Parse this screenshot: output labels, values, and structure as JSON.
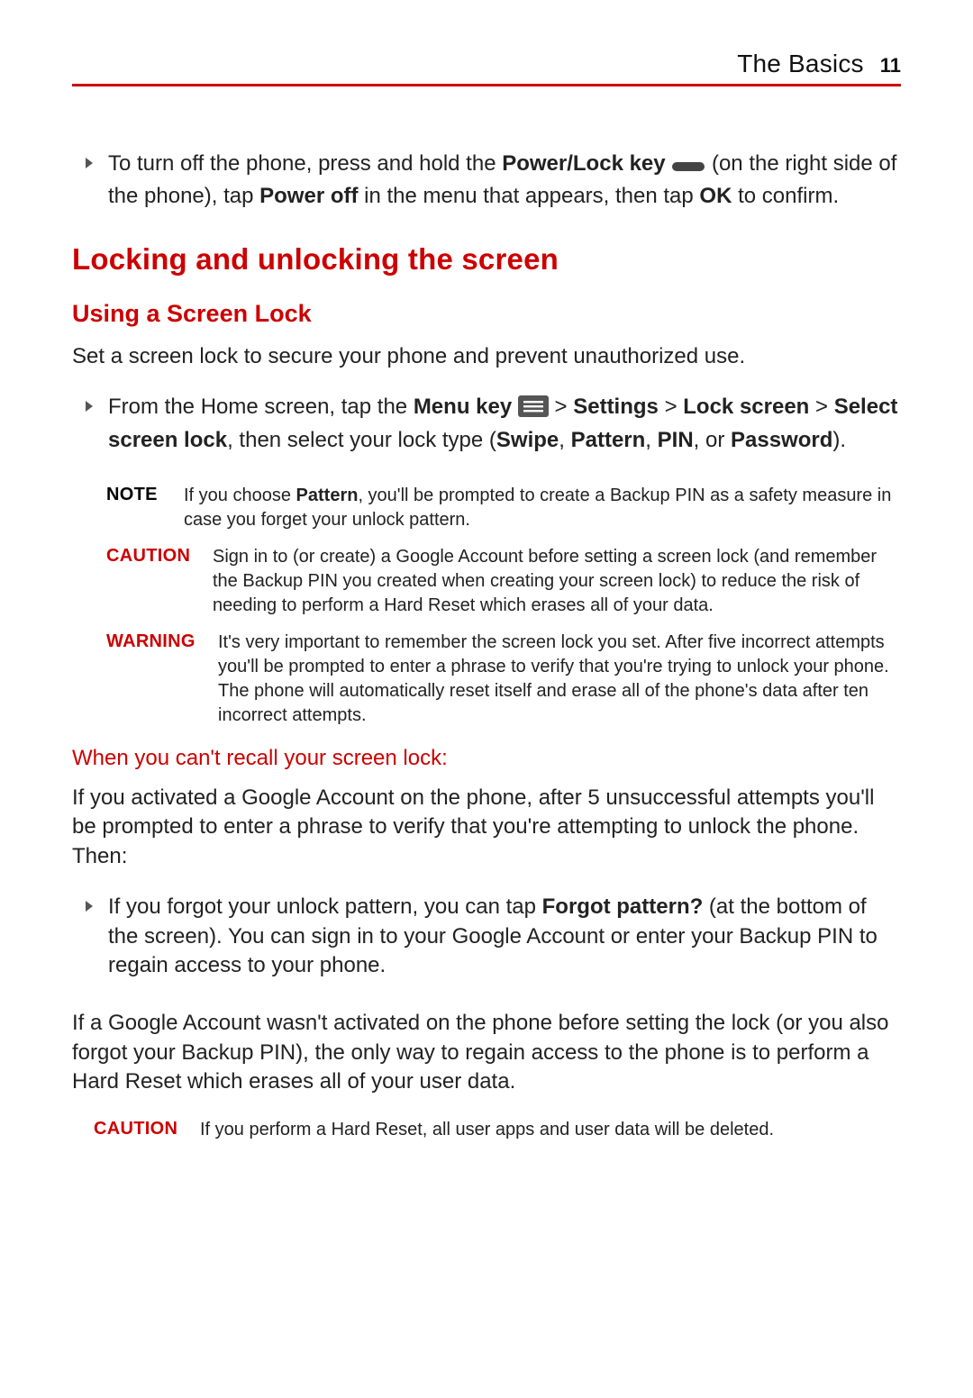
{
  "header": {
    "section": "The Basics",
    "page_number": "11"
  },
  "colors": {
    "accent": "#c00"
  },
  "bullet_power_off": {
    "pre_key": "To turn off the phone, press and hold the ",
    "key_bold": "Power/Lock key ",
    "after_icon": " (on the right side of the phone), tap ",
    "power_off_bold": "Power off",
    "mid2": " in the menu that appears, then tap ",
    "ok_bold": "OK",
    "tail": " to confirm."
  },
  "headings": {
    "locking_unlocking": "Locking and unlocking the screen",
    "using_screen_lock": "Using a Screen Lock",
    "cant_recall": "When you can't recall your screen lock:"
  },
  "screen_lock_intro": "Set a screen lock to secure your phone and prevent unauthorized use.",
  "bullet_screen_lock": {
    "pre": "From the Home screen, tap the ",
    "menu_key_bold": "Menu key ",
    "gt1": " > ",
    "settings_bold": "Settings",
    "gt2": " > ",
    "lock_screen_bold": "Lock screen",
    "gt3": " > ",
    "select_screen_lock_bold": "Select screen lock",
    "mid": ", then select your lock type (",
    "swipe_bold": "Swipe",
    "comma1": ", ",
    "pattern_bold": "Pattern",
    "comma2": ", ",
    "pin_bold": "PIN",
    "or_text": ", or ",
    "password_bold": "Password",
    "tail": ")."
  },
  "callouts": {
    "note": {
      "label": "NOTE",
      "pre": "If you choose ",
      "pattern_bold": "Pattern",
      "tail": ", you'll be prompted to create a Backup PIN as a safety measure in case you forget your unlock pattern."
    },
    "caution1": {
      "label": "CAUTION",
      "text": "Sign in to (or create) a Google Account before setting a screen lock (and remember the Backup PIN you created when creating your screen lock) to reduce the risk of needing to perform a Hard Reset which erases all of your data."
    },
    "warning": {
      "label": "WARNING",
      "text": "It's very important to remember the screen lock you set. After five incorrect attempts you'll be prompted to enter a phrase to verify that you're trying to unlock your phone. The phone will automatically reset itself and erase all of the phone's data after ten incorrect attempts."
    },
    "caution2": {
      "label": "CAUTION",
      "text": "If you perform a Hard Reset, all user apps and user data will be deleted."
    }
  },
  "recall_intro": "If you activated a Google Account on the phone, after 5 unsuccessful attempts you'll be prompted to enter a phrase to verify that you're attempting to unlock the phone. Then:",
  "bullet_forgot_pattern": {
    "pre": "If you forgot your unlock pattern, you can tap ",
    "forgot_bold": "Forgot pattern?",
    "tail": " (at the bottom of the screen). You can sign in to your Google Account or enter your Backup PIN to regain access to your phone."
  },
  "no_google_para": "If a Google Account wasn't activated on the phone before setting the lock (or you also forgot your Backup PIN), the only way to regain access to the phone is to perform a Hard Reset which erases all of your user data."
}
